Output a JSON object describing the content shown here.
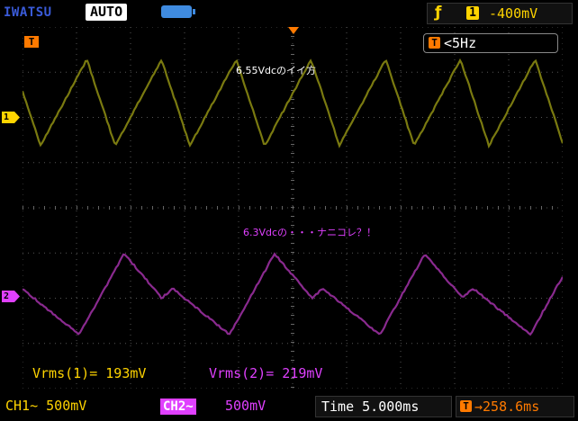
{
  "header": {
    "brand": "IWATSU",
    "mode": "AUTO",
    "trigger_source": "1",
    "trigger_level": "-400mV",
    "icons": [
      "battery-icon",
      "trigger-edge-icon"
    ]
  },
  "screen": {
    "trigger_marker": "T",
    "freq_marker": "T",
    "freq_text": "<5Hz",
    "note_ch1": "6.55Vdcのイイ方",
    "note_ch2": "6.3Vdcの・・・ナニコレ？！",
    "ch1_marker": "1",
    "ch2_marker": "2"
  },
  "measurements": {
    "ch1": "Vrms(1)= 193mV",
    "ch2": "Vrms(2)= 219mV"
  },
  "footer": {
    "ch1": "CH1~ 500mV",
    "ch2_tag": "CH2~",
    "ch2_scale": "500mV",
    "time": "Time 5.000ms",
    "delay_icon": "T",
    "delay": "→258.6ms"
  },
  "colors": {
    "ch1": "#ffd400",
    "ch1_trace": "#7a7a10",
    "ch2": "#e040ff",
    "ch2_trace": "#8a2a8f",
    "trigger": "#ff7a00"
  }
}
